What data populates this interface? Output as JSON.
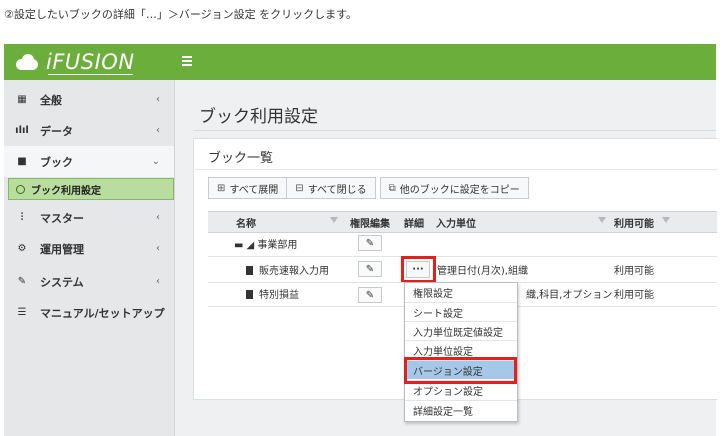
{
  "caption": "②設定したいブックの詳細「…」＞バージョン設定 をクリックします。",
  "app": {
    "logo_text": "iFUSION"
  },
  "sidebar": {
    "items": [
      {
        "label": "全般",
        "icon": "grid-icon"
      },
      {
        "label": "データ",
        "icon": "bar-chart-icon"
      },
      {
        "label": "ブック",
        "icon": "book-icon"
      },
      {
        "label": "ブック利用設定",
        "icon": "circle-icon"
      },
      {
        "label": "マスター",
        "icon": "sitemap-icon"
      },
      {
        "label": "運用管理",
        "icon": "gears-icon"
      },
      {
        "label": "システム",
        "icon": "wrench-icon"
      },
      {
        "label": "マニュアル/セットアップ",
        "icon": "list-icon"
      }
    ]
  },
  "main": {
    "title": "ブック利用設定",
    "panel_title": "ブック一覧",
    "buttons": {
      "expand_all": "すべて展開",
      "collapse_all": "すべて閉じる",
      "copy_settings": "他のブックに設定をコピー"
    },
    "table": {
      "columns": [
        "名称",
        "権限編集",
        "詳細",
        "入力単位",
        "利用可能"
      ],
      "rows": [
        {
          "name": "◢ 事業部用",
          "unit": "",
          "available": ""
        },
        {
          "name": "販売速報入力用",
          "unit": "管理日付(月次),組織",
          "available": "利用可能"
        },
        {
          "name": "特別損益",
          "unit": "織,科目,オプション",
          "available": "利用可能"
        }
      ]
    }
  },
  "detail_menu": {
    "items": [
      "権限設定",
      "シート設定",
      "入力単位既定値設定",
      "入力単位設定",
      "バージョン設定",
      "オプション設定",
      "詳細設定一覧"
    ],
    "selected": "バージョン設定"
  },
  "colors": {
    "brand": "#6cae3c",
    "highlight": "#e3211c",
    "selected": "#a6c8e8"
  }
}
